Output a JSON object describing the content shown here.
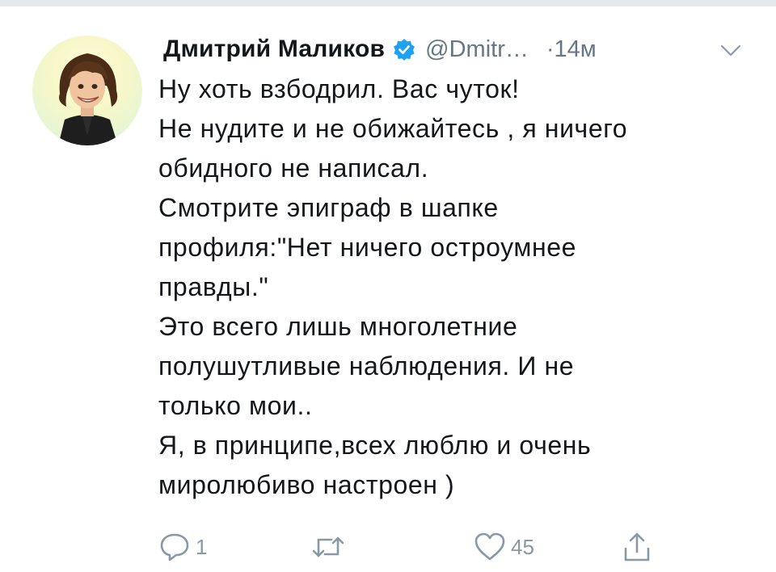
{
  "author": {
    "name": "Дмитрий Маликов",
    "handle": "@Dmitr…",
    "time": "·14м"
  },
  "tweet": {
    "lines": [
      "Ну хоть взбодрил. Вас чуток!",
      "Не нудите и не обижайтесь , я ничего",
      "обидного не написал.",
      "Смотрите эпиграф в шапке",
      "профиля:\"Нет ничего остроумнее",
      "правды.\"",
      "Это всего лишь многолетние",
      "полушутливые наблюдения. И не",
      "только мои..",
      "Я, в принципе,всех люблю и очень",
      "миролюбиво настроен )"
    ]
  },
  "actions": {
    "reply_count": "1",
    "retweet_count": "",
    "like_count": "45"
  },
  "colors": {
    "text": "#14171a",
    "secondary": "#657786",
    "icon": "#8899a6",
    "verified": "#1da1f2"
  },
  "icons": {
    "verified": "verified-badge-icon",
    "caret": "chevron-down-icon",
    "reply": "reply-icon",
    "retweet": "retweet-icon",
    "like": "heart-icon",
    "share": "share-icon"
  }
}
